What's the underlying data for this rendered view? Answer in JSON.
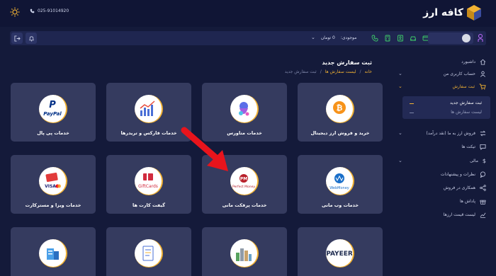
{
  "header": {
    "phone": "025-91014920",
    "logo_text": "کافه ارز"
  },
  "toolbar": {
    "balance_label": "موجودی:",
    "balance_value": "0 تومان"
  },
  "page": {
    "title": "ثبت سفارش جدید",
    "breadcrumb": [
      "خانه",
      "لیست سفارش ها",
      "ثبت سفارش جدید"
    ]
  },
  "cards": [
    {
      "label": "خرید و فروش ارز دیجیتال",
      "logo": "Crypto Currency",
      "icon": "crypto-icon"
    },
    {
      "label": "خدمات متاورس",
      "logo": "",
      "icon": "metaverse-icon"
    },
    {
      "label": "خدمات فارکس و تریدرها",
      "logo": "",
      "icon": "forex-chart-icon"
    },
    {
      "label": "خدمات پی پال",
      "logo": "PayPal",
      "icon": "paypal-icon"
    },
    {
      "label": "خدمات وب مانی",
      "logo": "WebMoney",
      "icon": "webmoney-icon"
    },
    {
      "label": "خدمات پرفکت مانی",
      "logo": "Perfect Money",
      "logo_mark": "PM",
      "icon": "perfect-money-icon"
    },
    {
      "label": "گیفت کارت ها",
      "logo": "GiftCards",
      "icon": "giftcard-icon"
    },
    {
      "label": "خدمات ویزا و مسترکارت",
      "logo": "VISA",
      "icon": "visa-mastercard-icon"
    },
    {
      "label": "",
      "logo": "PAYEER",
      "icon": "payeer-icon"
    },
    {
      "label": "",
      "logo": "",
      "icon": "city-icon"
    },
    {
      "label": "",
      "logo": "",
      "icon": "document-icon"
    },
    {
      "label": "",
      "logo": "",
      "icon": "server-icon"
    }
  ],
  "sidebar": {
    "items": [
      {
        "label": "داشبورد",
        "icon": "home-icon"
      },
      {
        "label": "حساب کاربری من",
        "icon": "user-icon"
      },
      {
        "label": "ثبت سفارش",
        "icon": "cart-icon"
      },
      {
        "label": "فروش ارز به ما (نقد درآمد)",
        "icon": "exchange-icon"
      },
      {
        "label": "تیکت ها",
        "icon": "ticket-icon"
      },
      {
        "label": "مالی",
        "icon": "dollar-icon"
      },
      {
        "label": "نظرات و پیشنهادات",
        "icon": "comment-icon"
      },
      {
        "label": "همکاری در فروش",
        "icon": "share-icon"
      },
      {
        "label": "پاداش ها",
        "icon": "gift-icon"
      },
      {
        "label": "لیست قیمت ارزها",
        "icon": "chart-icon"
      }
    ],
    "submenu": [
      "ثبت سفارش جدید",
      "لیست سفارش ها"
    ]
  },
  "colors": {
    "background": "#141a3a",
    "card": "#353b5f",
    "accent": "#f2b233",
    "arrow": "#e8141c"
  }
}
